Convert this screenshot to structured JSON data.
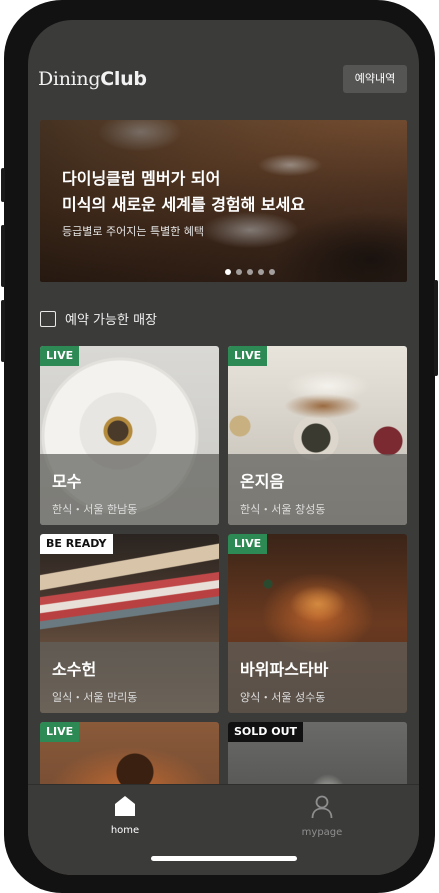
{
  "header": {
    "logo_light": "Dining",
    "logo_bold": "Club",
    "reservation_button": "예약내역"
  },
  "banner": {
    "title": "다이닝클럽 멤버가 되어\n미식의 새로운 세계를 경험해 보세요",
    "subtitle": "등급별로 주어지는 특별한 혜택",
    "page_count": 5,
    "active_page": 1
  },
  "filter": {
    "label": "예약 가능한 매장",
    "checked": false
  },
  "restaurants": [
    {
      "badge": "LIVE",
      "badge_type": "live",
      "name": "모수",
      "meta": "한식・서울 한남동"
    },
    {
      "badge": "LIVE",
      "badge_type": "live",
      "name": "온지음",
      "meta": "한식・서울 창성동"
    },
    {
      "badge": "BE READY",
      "badge_type": "ready",
      "name": "소수헌",
      "meta": "일식・서울 만리동"
    },
    {
      "badge": "LIVE",
      "badge_type": "live",
      "name": "바위파스타바",
      "meta": "양식・서울 성수동"
    },
    {
      "badge": "LIVE",
      "badge_type": "live",
      "name": "",
      "meta": ""
    },
    {
      "badge": "SOLD OUT",
      "badge_type": "soldout",
      "name": "",
      "meta": ""
    }
  ],
  "tabbar": {
    "home_label": "home",
    "mypage_label": "mypage",
    "active": "home"
  },
  "colors": {
    "screen_bg": "#3b3b3a",
    "live_badge": "#2e8a55",
    "inactive_tab": "#8e8e8e"
  }
}
